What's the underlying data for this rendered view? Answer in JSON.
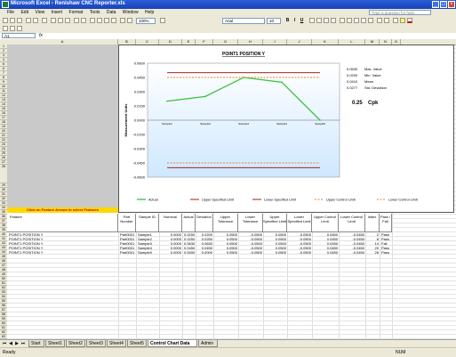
{
  "app": {
    "title": "Microsoft Excel - Renishaw CNC Reporter.xls"
  },
  "window_buttons": [
    "_",
    "□",
    "×"
  ],
  "menu": [
    "File",
    "Edit",
    "View",
    "Insert",
    "Format",
    "Tools",
    "Data",
    "Window",
    "Help"
  ],
  "help_placeholder": "Type a question for help",
  "formatting": {
    "font": "Arial",
    "size": "10",
    "zoom": "100%"
  },
  "name_box": "A1",
  "fx": "fx",
  "columns": [
    "A",
    "B",
    "C",
    "D",
    "E",
    "F",
    "G",
    "H",
    "I",
    "J",
    "K",
    "L",
    "M",
    "N",
    "O"
  ],
  "notice": "Click on Feature Arrows to select Features",
  "chart": {
    "title": "POINT1 POSITION Y",
    "ylabel": "Measurement Units",
    "stats": {
      "max_value": "0.0630",
      "max_label": "Max. Value",
      "min_value": "0.0200",
      "min_label": "Min. Value",
      "mean_value": "0.0410",
      "mean_label": "Mean",
      "stdev_value": "0.0277",
      "stdev_label": "Std. Deviation",
      "cpk_value": "0.25",
      "cpk_label": "Cpk"
    },
    "legend": [
      "Actual",
      "Upper Specified Limit",
      "Lower Specified Limit",
      "Upper Control Limit",
      "Lower Control Limit"
    ]
  },
  "chart_data": {
    "type": "line",
    "title": "POINT1 POSITION Y",
    "ylabel": "Measurement Units",
    "categories": [
      "Sample1",
      "Sample2",
      "Sample3",
      "Sample4",
      "Sample5"
    ],
    "y_ticks": [
      "0.0600",
      "0.0450",
      "0.0300",
      "0.0150",
      "0.0000",
      "-0.0150",
      "-0.0300",
      "-0.0450",
      "-0.0600"
    ],
    "ylim": [
      -0.06,
      0.06
    ],
    "grid": false,
    "legend_position": "bottom",
    "series": [
      {
        "name": "Actual",
        "color": "#3cc03c",
        "values": [
          0.02,
          0.025,
          0.045,
          0.04,
          0.0
        ]
      },
      {
        "name": "Upper Specified Limit",
        "color": "#a00000",
        "values": [
          0.05,
          0.05,
          0.05,
          0.05,
          0.05
        ]
      },
      {
        "name": "Lower Specified Limit",
        "color": "#a00000",
        "values": [
          -0.05,
          -0.05,
          -0.05,
          -0.05,
          -0.05
        ]
      },
      {
        "name": "Upper Control Limit",
        "color": "#e08a2a",
        "values": [
          0.045,
          0.045,
          0.045,
          0.045,
          0.045
        ]
      },
      {
        "name": "Lower Control Limit",
        "color": "#e08a2a",
        "values": [
          -0.045,
          -0.045,
          -0.045,
          -0.045,
          -0.045
        ]
      }
    ]
  },
  "table": {
    "headers": [
      "Feature",
      "Part Number",
      "Sample ID",
      "Nominal",
      "Actual",
      "Deviation",
      "Upper Tolerance",
      "Lower Tolerance",
      "Upper Specified Limit",
      "Lower Specified Limit",
      "Upper Control Limit",
      "Lower Control Limit",
      "Index",
      "Pass / Fail"
    ],
    "rows": [
      [
        "POINT1 POSITION Y",
        "Part0001",
        "Sample1",
        "0.0000",
        "0.0200",
        "0.0200",
        "0.0500",
        "-0.0500",
        "0.0500",
        "-0.0500",
        "0.0450",
        "-0.0450",
        "2",
        "Pass"
      ],
      [
        "POINT1 POSITION Y",
        "Part0001",
        "Sample2",
        "0.0000",
        "0.0250",
        "0.0250",
        "0.0500",
        "-0.0500",
        "0.0500",
        "-0.0500",
        "0.0450",
        "-0.0450",
        "8",
        "Pass"
      ],
      [
        "POINT1 POSITION Y",
        "Part0001",
        "Sample3",
        "0.0000",
        "0.0630",
        "0.0630",
        "0.0500",
        "-0.0500",
        "0.0500",
        "-0.0500",
        "0.0450",
        "-0.0450",
        "14",
        "Fail"
      ],
      [
        "POINT1 POSITION Y",
        "Part0001",
        "Sample4",
        "0.0000",
        "0.0450",
        "0.0450",
        "0.0500",
        "-0.0500",
        "0.0500",
        "-0.0500",
        "0.0450",
        "-0.0450",
        "20",
        "Pass"
      ],
      [
        "POINT1 POSITION Y",
        "Part0001",
        "Sample5",
        "0.0000",
        "0.0000",
        "0.0000",
        "0.0500",
        "-0.0500",
        "0.0500",
        "-0.0500",
        "0.0450",
        "-0.0450",
        "26",
        "Pass"
      ]
    ]
  },
  "sheet_tabs": [
    "Start",
    "Sheet1",
    "Sheet2",
    "Sheet3",
    "Sheet4",
    "Sheet5",
    "Control Chart Data",
    "Admin"
  ],
  "active_tab": "Control Chart Data",
  "status": {
    "ready": "Ready",
    "num": "NUM"
  }
}
